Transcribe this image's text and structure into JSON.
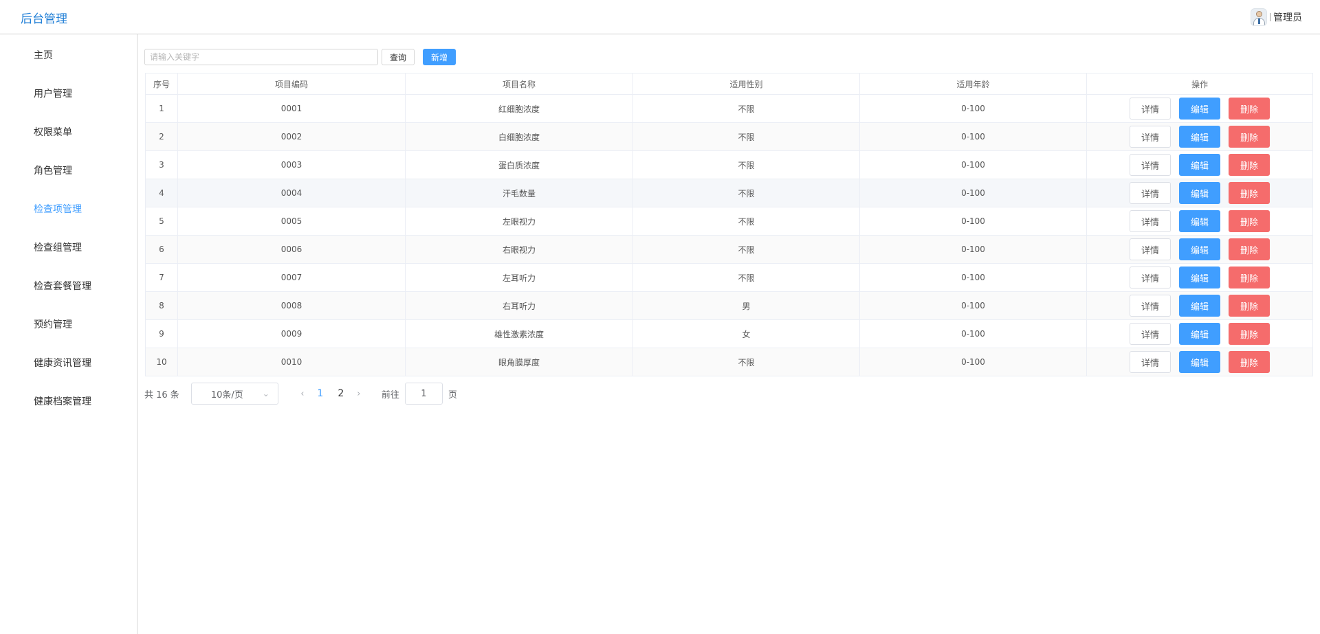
{
  "app": {
    "title": "后台管理"
  },
  "user": {
    "name": "管理员",
    "avatar_icon": "doctor-avatar-icon"
  },
  "sidebar": {
    "active_index": 4,
    "items": [
      {
        "label": "主页"
      },
      {
        "label": "用户管理"
      },
      {
        "label": "权限菜单"
      },
      {
        "label": "角色管理"
      },
      {
        "label": "检查项管理"
      },
      {
        "label": "检查组管理"
      },
      {
        "label": "检查套餐管理"
      },
      {
        "label": "预约管理"
      },
      {
        "label": "健康资讯管理"
      },
      {
        "label": "健康档案管理"
      }
    ]
  },
  "toolbar": {
    "search_placeholder": "请输入关键字",
    "search_value": "",
    "query_label": "查询",
    "add_label": "新增"
  },
  "table": {
    "columns": [
      "序号",
      "项目编码",
      "项目名称",
      "适用性别",
      "适用年龄",
      "操作"
    ],
    "actions": {
      "detail": "详情",
      "edit": "编辑",
      "delete": "删除"
    },
    "rows": [
      {
        "index": "1",
        "code": "0001",
        "name": "红细胞浓度",
        "gender": "不限",
        "age": "0-100"
      },
      {
        "index": "2",
        "code": "0002",
        "name": "白细胞浓度",
        "gender": "不限",
        "age": "0-100"
      },
      {
        "index": "3",
        "code": "0003",
        "name": "蛋白质浓度",
        "gender": "不限",
        "age": "0-100"
      },
      {
        "index": "4",
        "code": "0004",
        "name": "汗毛数量",
        "gender": "不限",
        "age": "0-100"
      },
      {
        "index": "5",
        "code": "0005",
        "name": "左眼视力",
        "gender": "不限",
        "age": "0-100"
      },
      {
        "index": "6",
        "code": "0006",
        "name": "右眼视力",
        "gender": "不限",
        "age": "0-100"
      },
      {
        "index": "7",
        "code": "0007",
        "name": "左耳听力",
        "gender": "不限",
        "age": "0-100"
      },
      {
        "index": "8",
        "code": "0008",
        "name": "右耳听力",
        "gender": "男",
        "age": "0-100"
      },
      {
        "index": "9",
        "code": "0009",
        "name": "雄性激素浓度",
        "gender": "女",
        "age": "0-100"
      },
      {
        "index": "10",
        "code": "0010",
        "name": "眼角膜厚度",
        "gender": "不限",
        "age": "0-100"
      }
    ]
  },
  "pagination": {
    "total_text": "共 16 条",
    "page_size_label": "10条/页",
    "pages": [
      "1",
      "2"
    ],
    "current_page": "1",
    "goto_label": "前往",
    "goto_value": "1",
    "page_unit": "页",
    "prev_icon": "chevron-left-icon",
    "next_icon": "chevron-right-icon"
  },
  "colors": {
    "accent": "#409eff",
    "brand": "#1f7ed6",
    "danger": "#f56c6c"
  }
}
